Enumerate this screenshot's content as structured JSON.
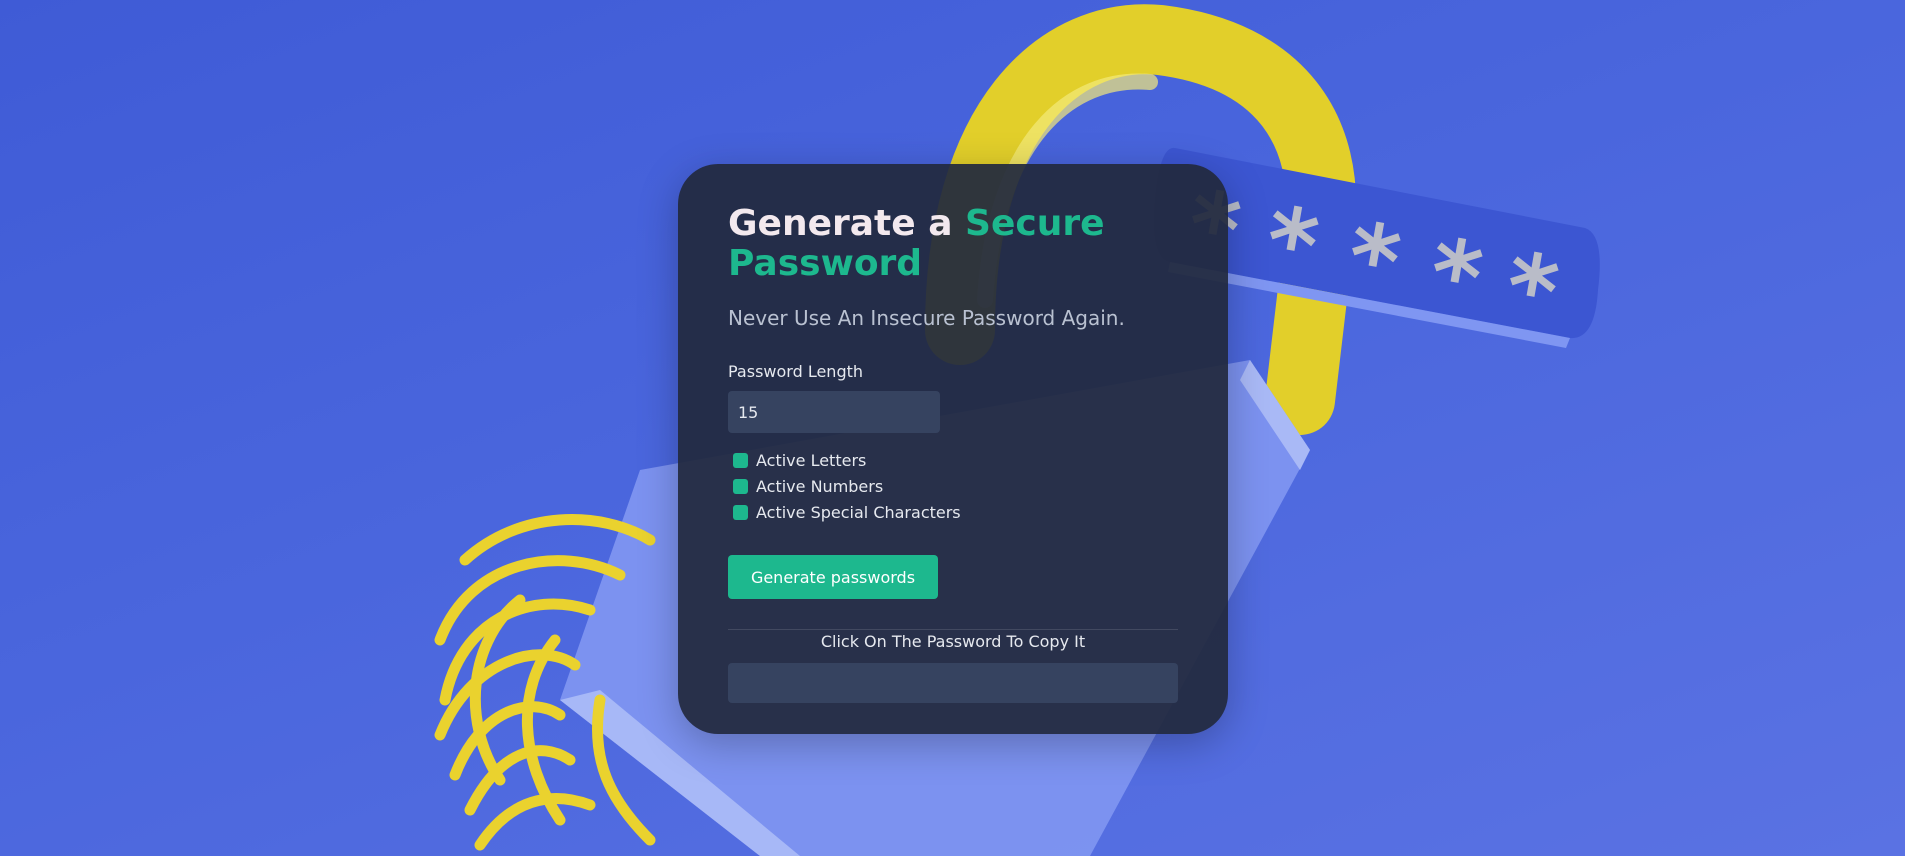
{
  "card": {
    "title_part1": "Generate a ",
    "title_accent": "Secure Password",
    "subtitle": "Never Use An Insecure Password Again.",
    "length_label": "Password Length",
    "length_value": "15",
    "options": [
      {
        "label": "Active Letters",
        "checked": true
      },
      {
        "label": "Active Numbers",
        "checked": true
      },
      {
        "label": "Active Special Characters",
        "checked": true
      }
    ],
    "generate_label": "Generate passwords",
    "copy_hint": "Click On The Password To Copy It",
    "output_value": ""
  },
  "colors": {
    "accent": "#1db88e",
    "background": "#4a66dd",
    "card": "#21293d"
  },
  "decoration": {
    "icons": [
      "padlock-illustration",
      "fingerprint-illustration",
      "password-asterisks-illustration"
    ]
  }
}
